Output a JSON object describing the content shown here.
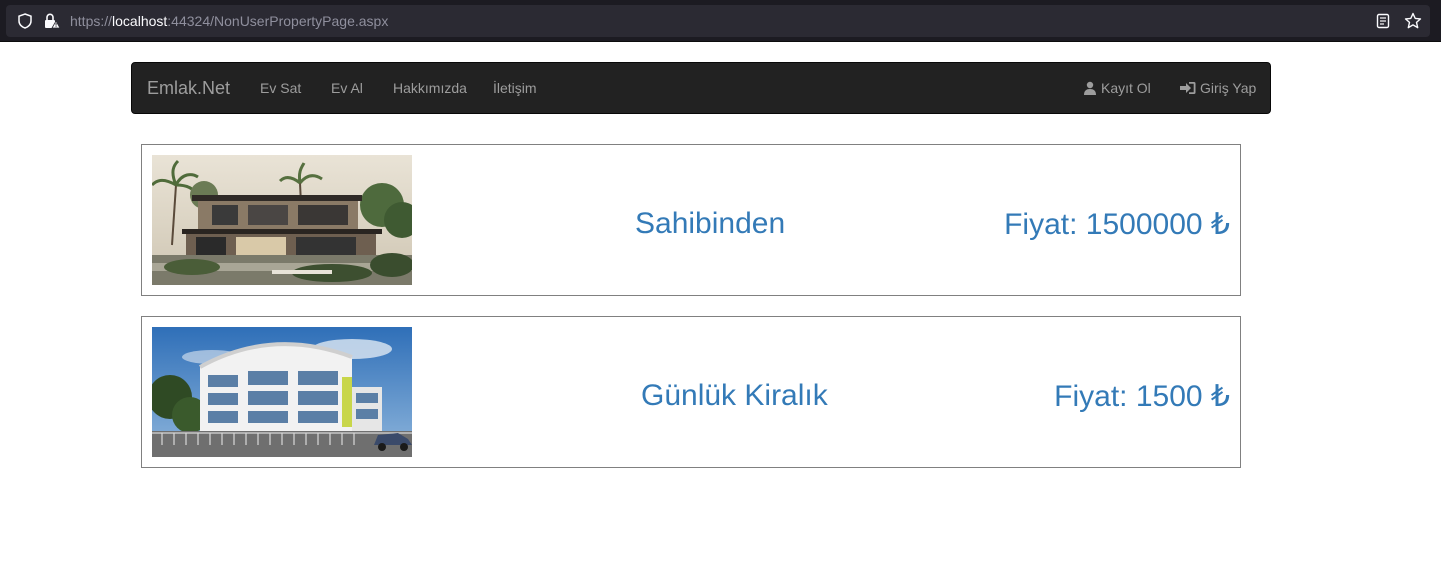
{
  "browser": {
    "url_prefix": "https://",
    "url_host": "localhost",
    "url_rest": ":44324/NonUserPropertyPage.aspx"
  },
  "navbar": {
    "brand": "Emlak.Net",
    "items": [
      {
        "label": "Ev Sat"
      },
      {
        "label": "Ev Al"
      },
      {
        "label": "Hakkımızda"
      },
      {
        "label": "İletişim"
      }
    ],
    "register_label": "Kayıt Ol",
    "login_label": "Giriş Yap"
  },
  "listings": [
    {
      "type": "Sahibinden",
      "price": "Fiyat: 1500000 ₺"
    },
    {
      "type": "Günlük Kiralık",
      "price": "Fiyat: 1500 ₺"
    }
  ],
  "colors": {
    "navbar_bg": "#222222",
    "nav_text": "#9d9d9d",
    "link_blue": "#337ab7",
    "browser_bg": "#1c1b22"
  }
}
